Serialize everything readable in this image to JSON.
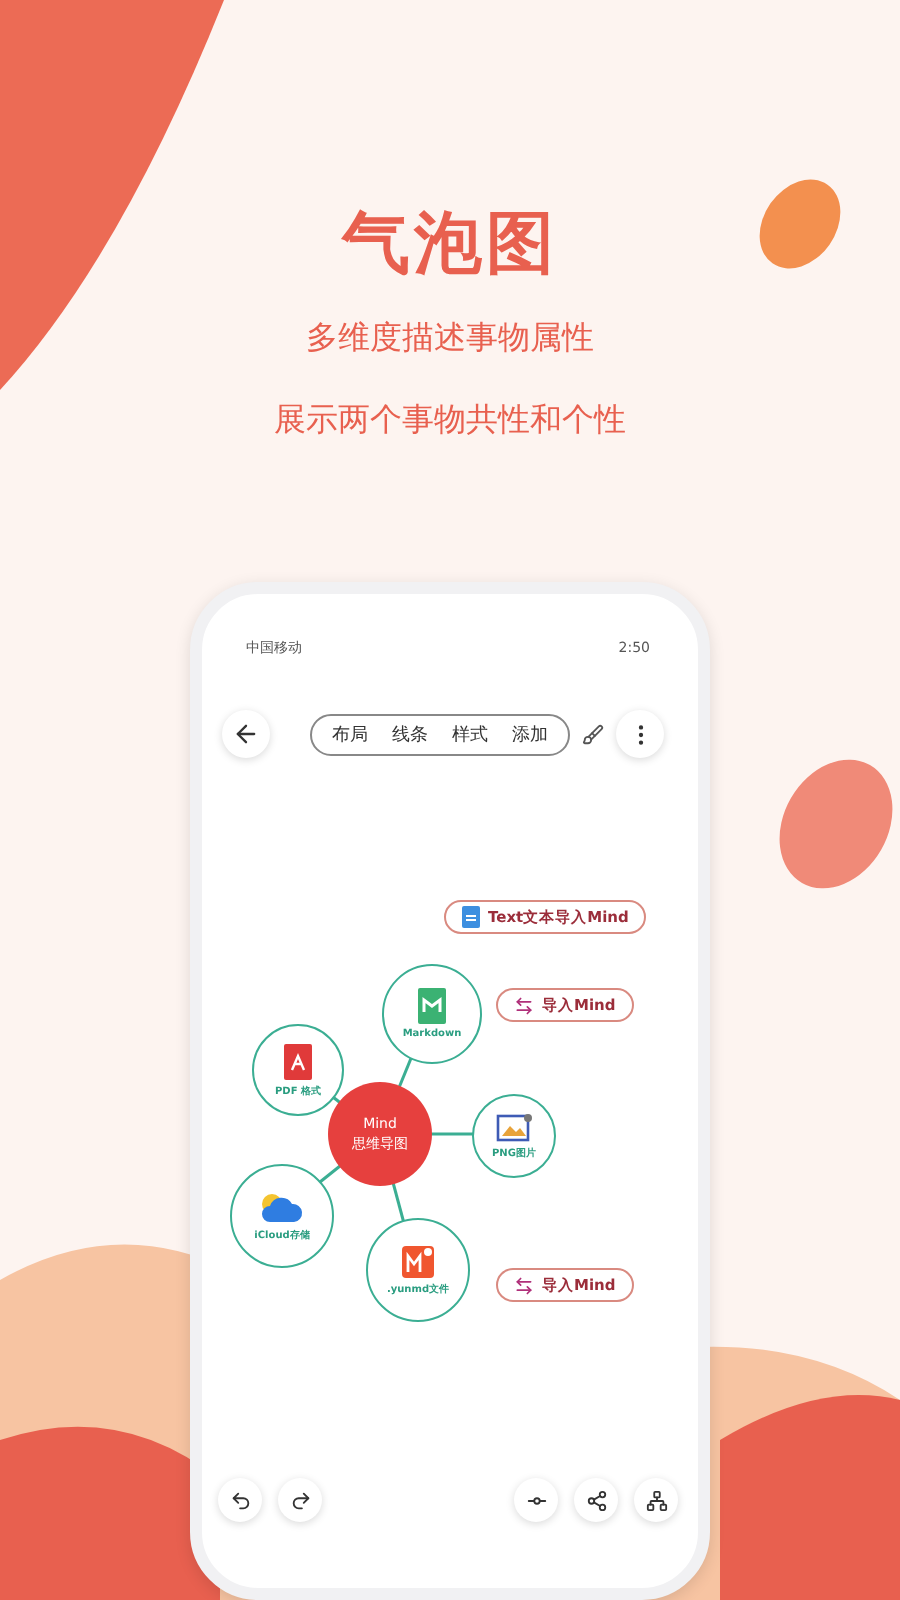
{
  "headline": "气泡图",
  "subtitles": [
    "多维度描述事物属性",
    "展示两个事物共性和个性"
  ],
  "phone": {
    "status_bar": {
      "carrier": "中国移动",
      "time": "2:50"
    },
    "toolbar": {
      "tabs": [
        {
          "label": "布局"
        },
        {
          "label": "线条"
        },
        {
          "label": "样式"
        },
        {
          "label": "添加"
        }
      ]
    },
    "mind_map": {
      "center": [
        "Mind",
        "思维导图"
      ],
      "nodes": [
        {
          "kind": "markdown",
          "label": "Markdown"
        },
        {
          "kind": "pdf",
          "label": "PDF 格式"
        },
        {
          "kind": "png",
          "label": "PNG图片"
        },
        {
          "kind": "cloud",
          "label": "iCloud存储"
        },
        {
          "kind": "yunmd",
          "label": ".yunmd文件"
        }
      ]
    },
    "import_buttons": [
      {
        "kind": "text",
        "label": "Text文本导入Mind"
      },
      {
        "kind": "swap",
        "label": "导入Mind"
      },
      {
        "kind": "swap",
        "label": "导入Mind"
      }
    ]
  }
}
